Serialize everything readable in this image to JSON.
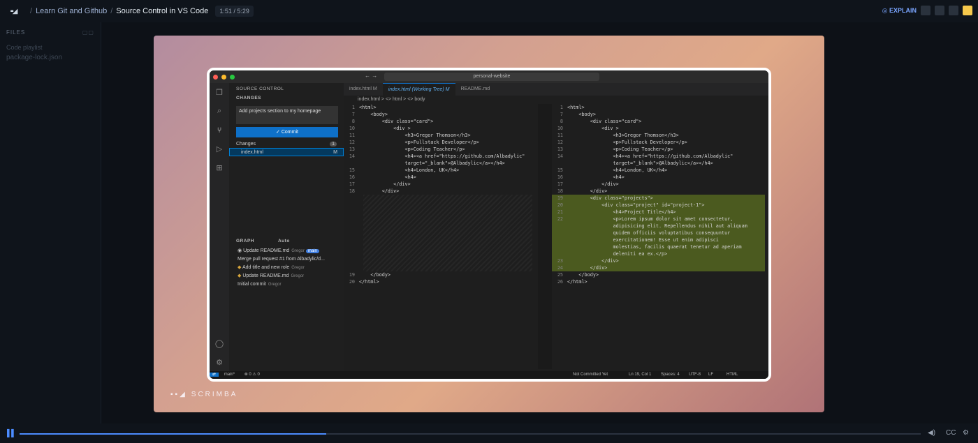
{
  "topbar": {
    "course": "Learn Git and Github",
    "lesson": "Source Control in VS Code",
    "time": "1:51 / 5:29",
    "explain": "EXPLAIN"
  },
  "files": {
    "header": "FILES",
    "items": [
      "Code playlist",
      "package-lock.json"
    ]
  },
  "brand": "SCRIMBA",
  "vscode": {
    "search": "personal-website",
    "sidebar": {
      "title": "SOURCE CONTROL",
      "changes_header": "CHANGES",
      "message": "Add projects section to my homepage",
      "commit": "Commit",
      "changes_label": "Changes",
      "changes_count": "1",
      "file": "index.html",
      "file_status": "M",
      "graph_header": "GRAPH",
      "graph_mode": "Auto",
      "branch_badge": "main",
      "graph": [
        {
          "msg": "Update README.md",
          "author": "Gregor"
        },
        {
          "msg": "Merge pull request #1 from Albadylic/d...",
          "author": ""
        },
        {
          "msg": "Add title and new role",
          "author": "Gregor"
        },
        {
          "msg": "Update README.md",
          "author": "Gregor"
        },
        {
          "msg": "Initial commit",
          "author": "Gregor"
        }
      ]
    },
    "tabs": [
      {
        "label": "index.html",
        "mark": "M"
      },
      {
        "label": "index.html (Working Tree)",
        "mark": "M"
      },
      {
        "label": "README.md",
        "mark": ""
      }
    ],
    "breadcrumb": "index.html > <> html > <> body",
    "left_lines": [
      [
        "1",
        "<html>"
      ],
      [
        "7",
        "    <body>"
      ],
      [
        "8",
        "        <div class=\"card\">"
      ],
      [
        "10",
        "            <div >"
      ],
      [
        "11",
        "                <h3>Gregor Thomson</h3>"
      ],
      [
        "12",
        "                <p>Fullstack Developer</p>"
      ],
      [
        "13",
        "                <p>Coding Teacher</p>"
      ],
      [
        "14",
        "                <h4><a href=\"https://github.com/Albadylic\""
      ],
      [
        "",
        "                target=\"_blank\">@Albadylic</a></h4>"
      ],
      [
        "15",
        "                <h4>London, UK</h4>"
      ],
      [
        "16",
        "                <h4>"
      ],
      [
        "17",
        "            </div>"
      ],
      [
        "18",
        "        </div>"
      ]
    ],
    "left_tail": [
      [
        "19",
        "    </body>"
      ],
      [
        "20",
        "</html>"
      ]
    ],
    "right_lines": [
      [
        "1",
        "<html>"
      ],
      [
        "7",
        "    <body>"
      ],
      [
        "8",
        "        <div class=\"card\">"
      ],
      [
        "10",
        "            <div >"
      ],
      [
        "11",
        "                <h3>Gregor Thomson</h3>"
      ],
      [
        "12",
        "                <p>Fullstack Developer</p>"
      ],
      [
        "13",
        "                <p>Coding Teacher</p>"
      ],
      [
        "14",
        "                <h4><a href=\"https://github.com/Albadylic\""
      ],
      [
        "",
        "                target=\"_blank\">@Albadylic</a></h4>"
      ],
      [
        "15",
        "                <h4>London, UK</h4>"
      ],
      [
        "16",
        "                <h4>"
      ],
      [
        "17",
        "            </div>"
      ],
      [
        "18",
        "        </div>"
      ]
    ],
    "right_added": [
      [
        "19",
        "        <div class=\"projects\">"
      ],
      [
        "20",
        "            <div class=\"project\" id=\"project-1\">"
      ],
      [
        "21",
        "                <h4>Project Title</h4>"
      ],
      [
        "22",
        "                <p>Lorem ipsum dolor sit amet consectetur,"
      ],
      [
        "",
        "                adipisicing elit. Repellendus nihil aut aliquam"
      ],
      [
        "",
        "                quidem officiis voluptatibus consequuntur"
      ],
      [
        "",
        "                exercitationem! Esse ut enim adipisci"
      ],
      [
        "",
        "                molestias, facilis quaerat tenetur ad aperiam"
      ],
      [
        "",
        "                deleniti ea ex.</p>"
      ],
      [
        "23",
        "            </div>"
      ],
      [
        "24",
        "        </div>"
      ]
    ],
    "right_tail": [
      [
        "25",
        "    </body>"
      ],
      [
        "26",
        "</html>"
      ]
    ],
    "status": {
      "branch": "main*",
      "errors": "⊗ 0 ⚠ 0",
      "commit_state": "Not Committed Yet",
      "pos": "Ln 19, Col 1",
      "spaces": "Spaces: 4",
      "enc": "UTF-8",
      "eol": "LF",
      "lang": "HTML"
    }
  },
  "player": {
    "cc": "CC",
    "progress": 0.34
  }
}
